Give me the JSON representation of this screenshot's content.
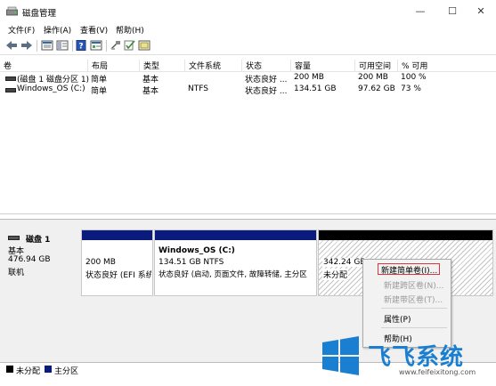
{
  "window": {
    "title": "磁盘管理",
    "minimize_glyph": "—",
    "maximize_glyph": "☐",
    "close_glyph": "✕"
  },
  "menu": [
    "文件(F)",
    "操作(A)",
    "查看(V)",
    "帮助(H)"
  ],
  "toolbar": {
    "icons": [
      "back-arrow-icon",
      "forward-arrow-icon",
      "volume-list-icon",
      "help-icon",
      "properties-icon",
      "connect-icon",
      "check-icon",
      "rescan-icon"
    ]
  },
  "table": {
    "headers": [
      "卷",
      "布局",
      "类型",
      "文件系统",
      "状态",
      "容量",
      "可用空间",
      "% 可用"
    ],
    "rows": [
      [
        "(磁盘 1 磁盘分区 1)",
        "简单",
        "基本",
        "",
        "状态良好 ...",
        "200 MB",
        "200 MB",
        "100 %"
      ],
      [
        "Windows_OS (C:)",
        "简单",
        "基本",
        "NTFS",
        "状态良好 ...",
        "134.51 GB",
        "97.62 GB",
        "73 %"
      ]
    ]
  },
  "disk": {
    "name": "磁盘 1",
    "type": "基本",
    "size": "476.94 GB",
    "status": "联机",
    "partitions": [
      {
        "title": "",
        "size": "200 MB",
        "desc": "状态良好 (EFI 系统",
        "bar_color": "#0b1a7d"
      },
      {
        "title": "Windows_OS  (C:)",
        "size": "134.51 GB NTFS",
        "desc": "状态良好 (启动, 页面文件, 故障转储, 主分区",
        "bar_color": "#0b1a7d"
      },
      {
        "title": "",
        "size": "342.24 GB",
        "desc": "未分配",
        "bar_color": "#000000"
      }
    ]
  },
  "legend": [
    {
      "label": "未分配",
      "color": "#000000"
    },
    {
      "label": "主分区",
      "color": "#0b1a7d"
    }
  ],
  "context_menu": {
    "items": [
      {
        "label": "新建简单卷(I)...",
        "enabled": true
      },
      {
        "label": "新建跨区卷(N)...",
        "enabled": false
      },
      {
        "label": "新建带区卷(T)...",
        "enabled": false
      },
      {
        "label": "属性(P)",
        "enabled": true
      },
      {
        "label": "帮助(H)",
        "enabled": true
      }
    ]
  },
  "watermark": {
    "text": "飞飞系统",
    "url": "www.feifeixitong.com",
    "color": "#1b7fd1"
  }
}
